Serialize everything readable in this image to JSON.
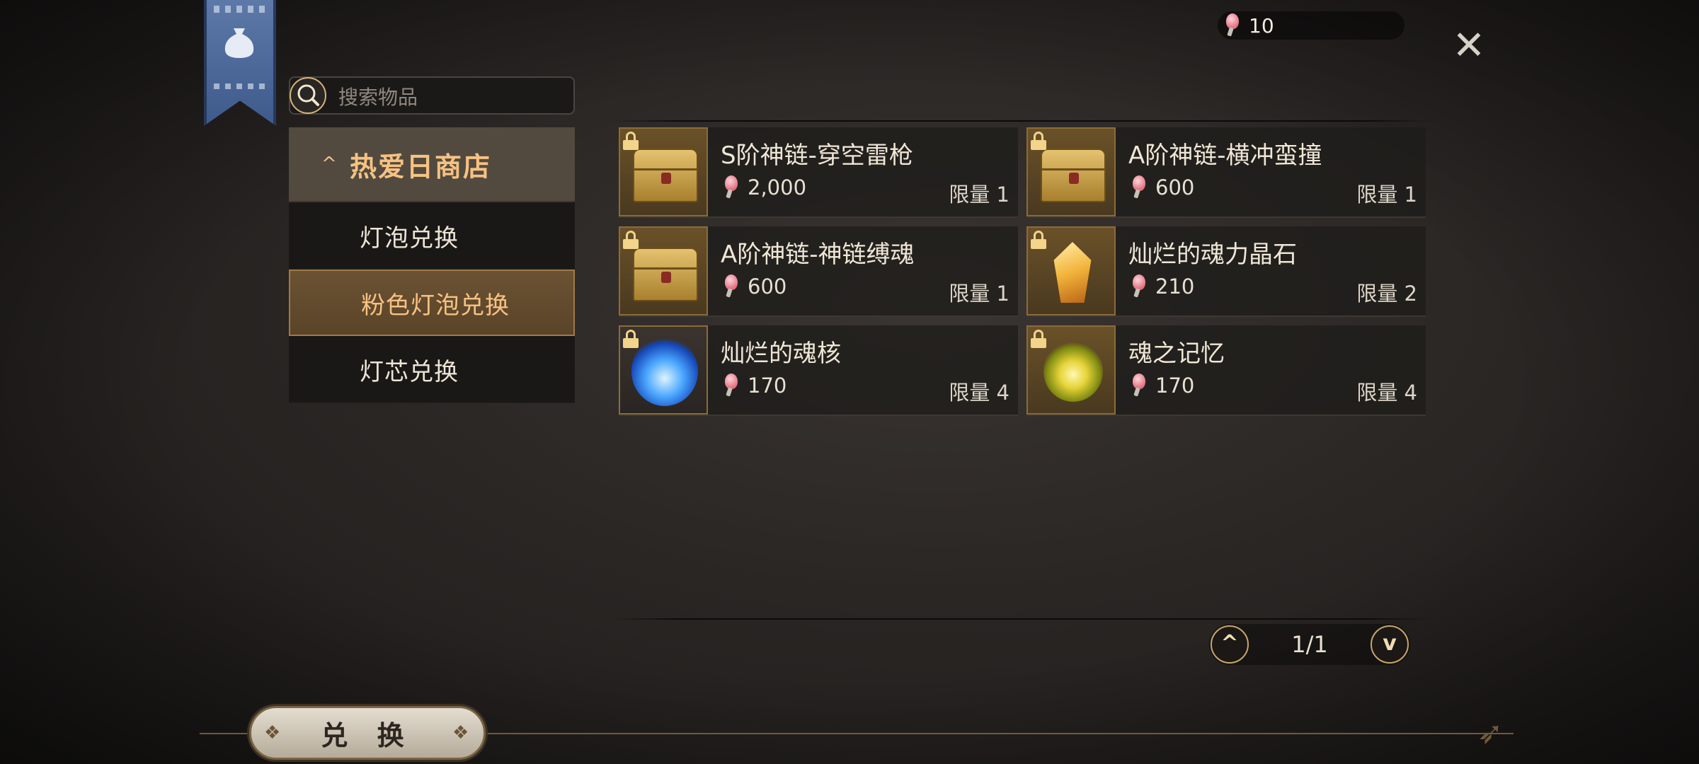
{
  "currency": {
    "icon": "pink-bulb-gem-icon",
    "amount": "10"
  },
  "search": {
    "placeholder": "搜索物品"
  },
  "sidebar": {
    "header": "热爱日商店",
    "items": [
      {
        "label": "灯泡兑换",
        "active": false
      },
      {
        "label": "粉色灯泡兑换",
        "active": true
      },
      {
        "label": "灯芯兑换",
        "active": false
      }
    ]
  },
  "items": [
    {
      "name": "S阶神链-穿空雷枪",
      "price": "2,000",
      "limit": "限量 1",
      "icon": "golden-chest-icon"
    },
    {
      "name": "A阶神链-横冲蛮撞",
      "price": "600",
      "limit": "限量 1",
      "icon": "golden-chest-icon"
    },
    {
      "name": "A阶神链-神链缚魂",
      "price": "600",
      "limit": "限量 1",
      "icon": "golden-chest-icon"
    },
    {
      "name": "灿烂的魂力晶石",
      "price": "210",
      "limit": "限量 2",
      "icon": "soul-crystal-icon"
    },
    {
      "name": "灿烂的魂核",
      "price": "170",
      "limit": "限量 4",
      "icon": "blue-soul-core-icon"
    },
    {
      "name": "魂之记忆",
      "price": "170",
      "limit": "限量 4",
      "icon": "soul-memory-orb-icon"
    }
  ],
  "pager": {
    "page": "1/1"
  },
  "actions": {
    "exchange": "兑 换"
  },
  "colors": {
    "accent": "#f6c283",
    "active_bg": "#5a4428",
    "banner": "#4a6699"
  }
}
